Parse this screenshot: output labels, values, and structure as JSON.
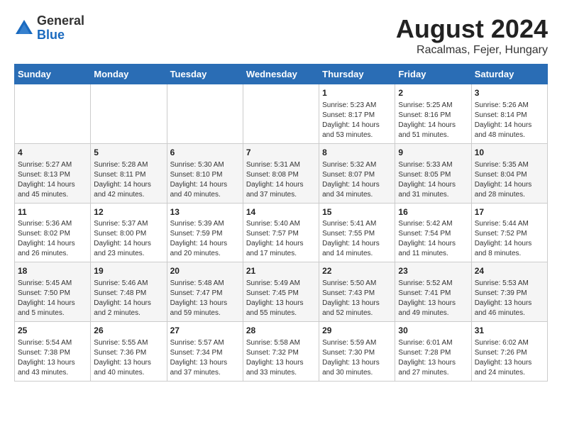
{
  "logo": {
    "general": "General",
    "blue": "Blue"
  },
  "title": "August 2024",
  "subtitle": "Racalmas, Fejer, Hungary",
  "headers": [
    "Sunday",
    "Monday",
    "Tuesday",
    "Wednesday",
    "Thursday",
    "Friday",
    "Saturday"
  ],
  "weeks": [
    [
      {
        "day": "",
        "info": ""
      },
      {
        "day": "",
        "info": ""
      },
      {
        "day": "",
        "info": ""
      },
      {
        "day": "",
        "info": ""
      },
      {
        "day": "1",
        "info": "Sunrise: 5:23 AM\nSunset: 8:17 PM\nDaylight: 14 hours\nand 53 minutes."
      },
      {
        "day": "2",
        "info": "Sunrise: 5:25 AM\nSunset: 8:16 PM\nDaylight: 14 hours\nand 51 minutes."
      },
      {
        "day": "3",
        "info": "Sunrise: 5:26 AM\nSunset: 8:14 PM\nDaylight: 14 hours\nand 48 minutes."
      }
    ],
    [
      {
        "day": "4",
        "info": "Sunrise: 5:27 AM\nSunset: 8:13 PM\nDaylight: 14 hours\nand 45 minutes."
      },
      {
        "day": "5",
        "info": "Sunrise: 5:28 AM\nSunset: 8:11 PM\nDaylight: 14 hours\nand 42 minutes."
      },
      {
        "day": "6",
        "info": "Sunrise: 5:30 AM\nSunset: 8:10 PM\nDaylight: 14 hours\nand 40 minutes."
      },
      {
        "day": "7",
        "info": "Sunrise: 5:31 AM\nSunset: 8:08 PM\nDaylight: 14 hours\nand 37 minutes."
      },
      {
        "day": "8",
        "info": "Sunrise: 5:32 AM\nSunset: 8:07 PM\nDaylight: 14 hours\nand 34 minutes."
      },
      {
        "day": "9",
        "info": "Sunrise: 5:33 AM\nSunset: 8:05 PM\nDaylight: 14 hours\nand 31 minutes."
      },
      {
        "day": "10",
        "info": "Sunrise: 5:35 AM\nSunset: 8:04 PM\nDaylight: 14 hours\nand 28 minutes."
      }
    ],
    [
      {
        "day": "11",
        "info": "Sunrise: 5:36 AM\nSunset: 8:02 PM\nDaylight: 14 hours\nand 26 minutes."
      },
      {
        "day": "12",
        "info": "Sunrise: 5:37 AM\nSunset: 8:00 PM\nDaylight: 14 hours\nand 23 minutes."
      },
      {
        "day": "13",
        "info": "Sunrise: 5:39 AM\nSunset: 7:59 PM\nDaylight: 14 hours\nand 20 minutes."
      },
      {
        "day": "14",
        "info": "Sunrise: 5:40 AM\nSunset: 7:57 PM\nDaylight: 14 hours\nand 17 minutes."
      },
      {
        "day": "15",
        "info": "Sunrise: 5:41 AM\nSunset: 7:55 PM\nDaylight: 14 hours\nand 14 minutes."
      },
      {
        "day": "16",
        "info": "Sunrise: 5:42 AM\nSunset: 7:54 PM\nDaylight: 14 hours\nand 11 minutes."
      },
      {
        "day": "17",
        "info": "Sunrise: 5:44 AM\nSunset: 7:52 PM\nDaylight: 14 hours\nand 8 minutes."
      }
    ],
    [
      {
        "day": "18",
        "info": "Sunrise: 5:45 AM\nSunset: 7:50 PM\nDaylight: 14 hours\nand 5 minutes."
      },
      {
        "day": "19",
        "info": "Sunrise: 5:46 AM\nSunset: 7:48 PM\nDaylight: 14 hours\nand 2 minutes."
      },
      {
        "day": "20",
        "info": "Sunrise: 5:48 AM\nSunset: 7:47 PM\nDaylight: 13 hours\nand 59 minutes."
      },
      {
        "day": "21",
        "info": "Sunrise: 5:49 AM\nSunset: 7:45 PM\nDaylight: 13 hours\nand 55 minutes."
      },
      {
        "day": "22",
        "info": "Sunrise: 5:50 AM\nSunset: 7:43 PM\nDaylight: 13 hours\nand 52 minutes."
      },
      {
        "day": "23",
        "info": "Sunrise: 5:52 AM\nSunset: 7:41 PM\nDaylight: 13 hours\nand 49 minutes."
      },
      {
        "day": "24",
        "info": "Sunrise: 5:53 AM\nSunset: 7:39 PM\nDaylight: 13 hours\nand 46 minutes."
      }
    ],
    [
      {
        "day": "25",
        "info": "Sunrise: 5:54 AM\nSunset: 7:38 PM\nDaylight: 13 hours\nand 43 minutes."
      },
      {
        "day": "26",
        "info": "Sunrise: 5:55 AM\nSunset: 7:36 PM\nDaylight: 13 hours\nand 40 minutes."
      },
      {
        "day": "27",
        "info": "Sunrise: 5:57 AM\nSunset: 7:34 PM\nDaylight: 13 hours\nand 37 minutes."
      },
      {
        "day": "28",
        "info": "Sunrise: 5:58 AM\nSunset: 7:32 PM\nDaylight: 13 hours\nand 33 minutes."
      },
      {
        "day": "29",
        "info": "Sunrise: 5:59 AM\nSunset: 7:30 PM\nDaylight: 13 hours\nand 30 minutes."
      },
      {
        "day": "30",
        "info": "Sunrise: 6:01 AM\nSunset: 7:28 PM\nDaylight: 13 hours\nand 27 minutes."
      },
      {
        "day": "31",
        "info": "Sunrise: 6:02 AM\nSunset: 7:26 PM\nDaylight: 13 hours\nand 24 minutes."
      }
    ]
  ]
}
